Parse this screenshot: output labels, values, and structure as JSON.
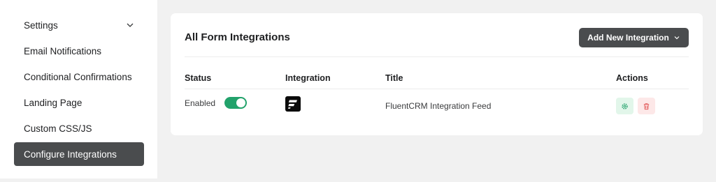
{
  "sidebar": {
    "items": [
      {
        "label": "Settings",
        "icon": "chevron-down-icon"
      },
      {
        "label": "Email Notifications"
      },
      {
        "label": "Conditional Confirmations"
      },
      {
        "label": "Landing Page"
      },
      {
        "label": "Custom CSS/JS"
      },
      {
        "label": "Configure Integrations",
        "active": true
      }
    ]
  },
  "main": {
    "title": "All Form Integrations",
    "add_button_label": "Add New Integration",
    "add_button_icon": "chevron-down-icon",
    "table": {
      "columns": [
        "Status",
        "Integration",
        "Title",
        "Actions"
      ],
      "rows": [
        {
          "status": "Enabled",
          "enabled": true,
          "integration_icon": "fluentcrm-logo-icon",
          "title": "FluentCRM Integration Feed",
          "actions": [
            "gear-icon",
            "trash-icon"
          ]
        }
      ]
    }
  },
  "colors": {
    "accent_dark": "#4a4c4e",
    "toggle_on": "#22a26b",
    "settings_action": "#22a26b",
    "delete_action": "#e35d5d"
  }
}
